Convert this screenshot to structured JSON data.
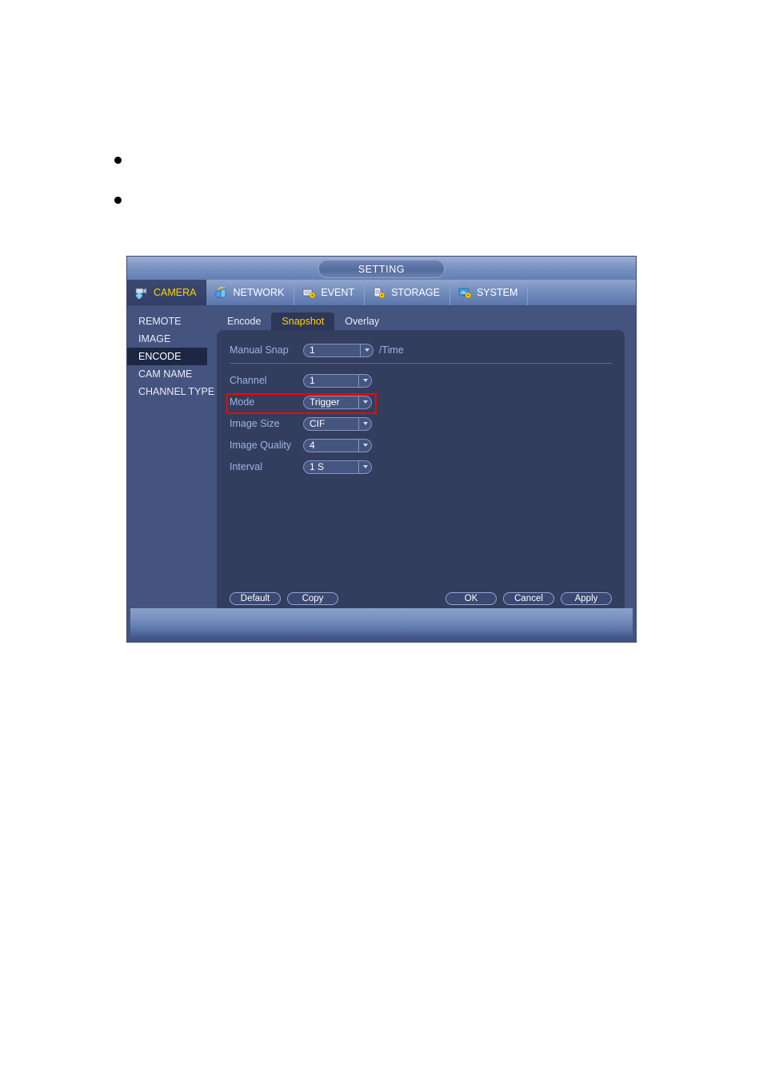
{
  "page": {
    "bullets": [
      "",
      ""
    ]
  },
  "window": {
    "title": "SETTING",
    "main_tabs": [
      {
        "label": "CAMERA",
        "icon": "camera-globe-icon",
        "active": true
      },
      {
        "label": "NETWORK",
        "icon": "network-switch-icon",
        "active": false
      },
      {
        "label": "EVENT",
        "icon": "event-gear-icon",
        "active": false
      },
      {
        "label": "STORAGE",
        "icon": "storage-gear-icon",
        "active": false
      },
      {
        "label": "SYSTEM",
        "icon": "system-monitor-gear-icon",
        "active": false
      }
    ],
    "sidebar": {
      "items": [
        {
          "label": "REMOTE",
          "active": false
        },
        {
          "label": "IMAGE",
          "active": false
        },
        {
          "label": "ENCODE",
          "active": true
        },
        {
          "label": "CAM NAME",
          "active": false
        },
        {
          "label": "CHANNEL TYPE",
          "active": false
        }
      ]
    },
    "sub_tabs": [
      {
        "label": "Encode",
        "active": false
      },
      {
        "label": "Snapshot",
        "active": true
      },
      {
        "label": "Overlay",
        "active": false
      }
    ],
    "form": {
      "manual_snap": {
        "label": "Manual Snap",
        "value": "1",
        "suffix": "/Time"
      },
      "channel": {
        "label": "Channel",
        "value": "1"
      },
      "mode": {
        "label": "Mode",
        "value": "Trigger",
        "highlighted": true
      },
      "image_size": {
        "label": "Image Size",
        "value": "CIF"
      },
      "image_quality": {
        "label": "Image Quality",
        "value": "4"
      },
      "interval": {
        "label": "Interval",
        "value": "1 S"
      }
    },
    "buttons": {
      "default": "Default",
      "copy": "Copy",
      "ok": "OK",
      "cancel": "Cancel",
      "apply": "Apply"
    },
    "colors": {
      "accent_yellow": "#ffd200",
      "highlight_red": "#ff0000",
      "panel_bg": "#333d5e",
      "frame_bg": "#45547e",
      "label_blue": "#9fb3e4"
    }
  }
}
